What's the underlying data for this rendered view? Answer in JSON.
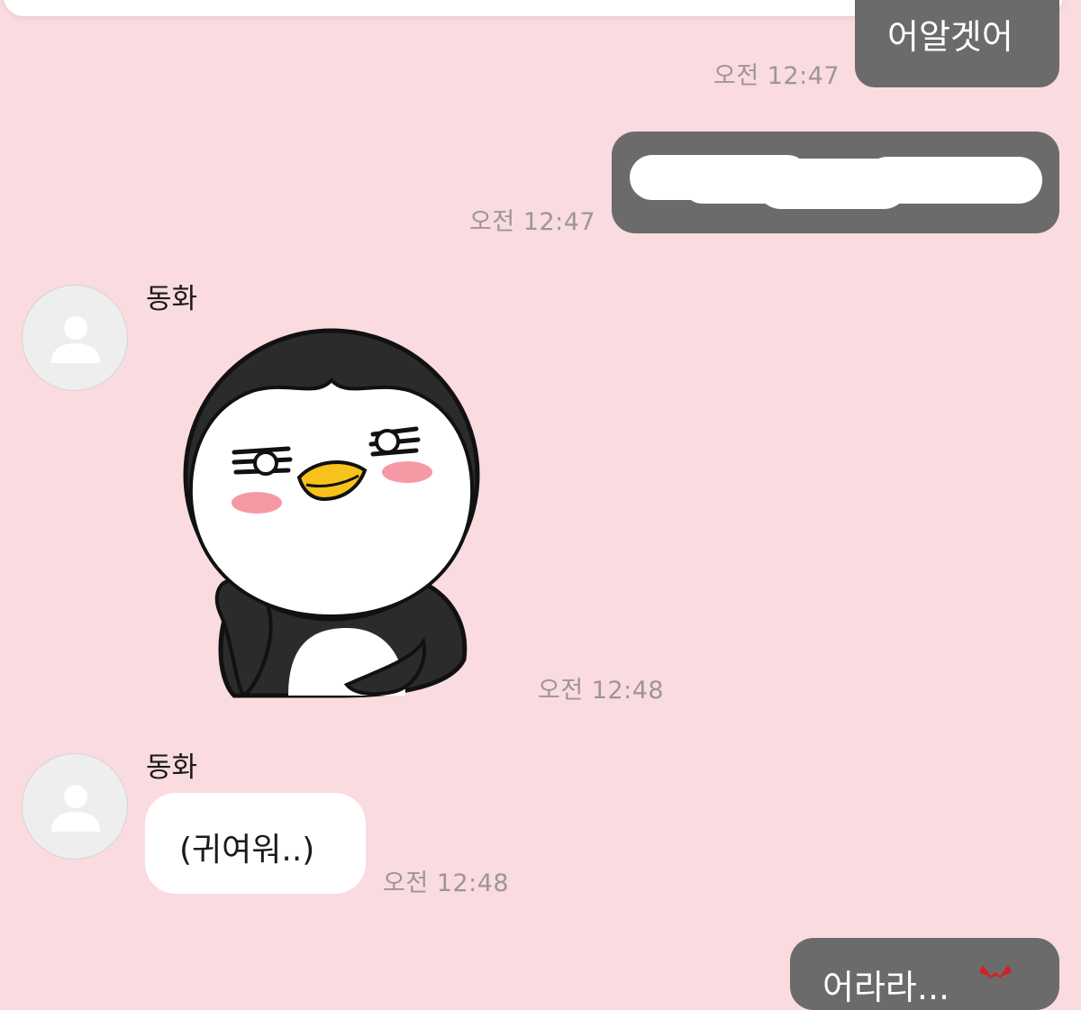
{
  "messages": {
    "m1": {
      "text": "어알겟어",
      "time": "오전 12:47"
    },
    "m2": {
      "time": "오전 12:47"
    },
    "m3": {
      "sender": "동화",
      "time": "오전 12:48"
    },
    "m4": {
      "sender": "동화",
      "text": "(귀여워..)",
      "time": "오전 12:48"
    },
    "m5": {
      "text": "어라라..."
    }
  },
  "icons": {
    "avatar": "default-person-icon",
    "sticker": "penguin-sticker"
  },
  "colors": {
    "background": "#f9dbe0",
    "outgoing_bubble": "#6b6b6b",
    "incoming_bubble": "#ffffff",
    "timestamp": "#9e9597"
  }
}
